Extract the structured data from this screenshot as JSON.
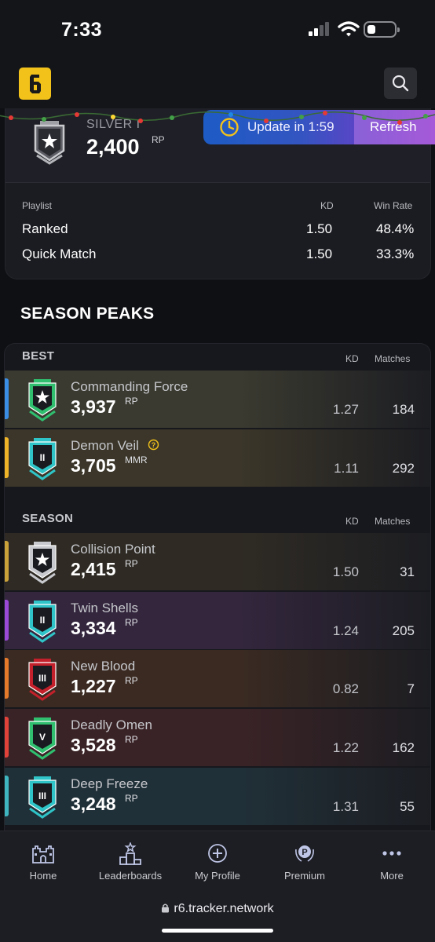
{
  "status_bar": {
    "time": "7:33"
  },
  "header": {
    "logo_glyph": "6",
    "search_icon": "search-icon"
  },
  "rank_card": {
    "rank_name": "SILVER I",
    "rp_value": "2,400",
    "rp_unit": "RP",
    "update_text": "Update in 1:59",
    "refresh_label": "Refresh",
    "stats_headers": {
      "playlist": "Playlist",
      "kd": "KD",
      "win_rate": "Win Rate"
    },
    "stats_rows": [
      {
        "playlist": "Ranked",
        "kd": "1.50",
        "win_rate": "48.4%"
      },
      {
        "playlist": "Quick Match",
        "kd": "1.50",
        "win_rate": "33.3%"
      }
    ]
  },
  "season_peaks": {
    "title": "SEASON PEAKS",
    "best": {
      "label": "BEST",
      "kd_header": "KD",
      "matches_header": "Matches",
      "rows": [
        {
          "name": "Commanding Force",
          "value": "3,937",
          "unit": "RP",
          "kd": "1.27",
          "matches": "184",
          "accent": "#3a8ee6",
          "tint": "#3a3a30",
          "badge_color": "#2fbf6f",
          "numeral": "★"
        },
        {
          "name": "Demon Veil",
          "value": "3,705",
          "unit": "MMR",
          "kd": "1.11",
          "matches": "292",
          "accent": "#f0b429",
          "tint": "#3b3629",
          "badge_color": "#2fc4c7",
          "numeral": "II",
          "help": true
        }
      ]
    },
    "season": {
      "label": "SEASON",
      "kd_header": "KD",
      "matches_header": "Matches",
      "rows": [
        {
          "name": "Collision Point",
          "value": "2,415",
          "unit": "RP",
          "kd": "1.50",
          "matches": "31",
          "accent": "#c9a23a",
          "tint": "#2f2b24",
          "badge_color": "#c8c9ce",
          "numeral": "★"
        },
        {
          "name": "Twin Shells",
          "value": "3,334",
          "unit": "RP",
          "kd": "1.24",
          "matches": "205",
          "accent": "#9b4ad8",
          "tint": "#33263d",
          "badge_color": "#2fc4c7",
          "numeral": "II"
        },
        {
          "name": "New Blood",
          "value": "1,227",
          "unit": "RP",
          "kd": "0.82",
          "matches": "7",
          "accent": "#e57a2b",
          "tint": "#3a2a22",
          "badge_color": "#c4202b",
          "numeral": "III"
        },
        {
          "name": "Deadly Omen",
          "value": "3,528",
          "unit": "RP",
          "kd": "1.22",
          "matches": "162",
          "accent": "#e0423a",
          "tint": "#3a2326",
          "badge_color": "#2fbf6f",
          "numeral": "V"
        },
        {
          "name": "Deep Freeze",
          "value": "3,248",
          "unit": "RP",
          "kd": "1.31",
          "matches": "55",
          "accent": "#3fb6bf",
          "tint": "#203038",
          "badge_color": "#2fc4c7",
          "numeral": "III"
        }
      ]
    }
  },
  "bottom_nav": [
    {
      "label": "Home",
      "icon": "castle-icon"
    },
    {
      "label": "Leaderboards",
      "icon": "podium-icon"
    },
    {
      "label": "My Profile",
      "icon": "plus-circle-icon"
    },
    {
      "label": "Premium",
      "icon": "premium-badge-icon"
    },
    {
      "label": "More",
      "icon": "more-dots-icon"
    }
  ],
  "url_bar": {
    "url": "r6.tracker.network"
  }
}
